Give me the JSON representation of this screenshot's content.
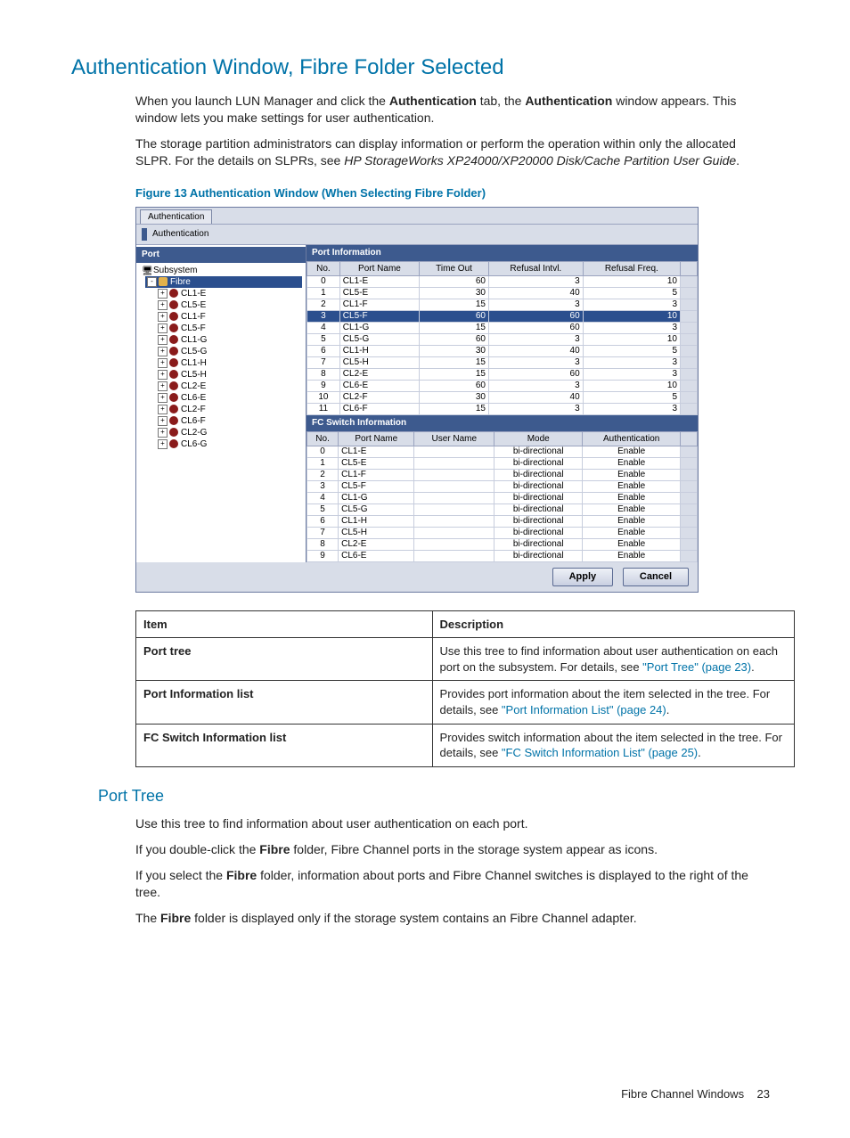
{
  "h1": "Authentication Window, Fibre Folder Selected",
  "p1a": "When you launch LUN Manager and click the ",
  "p1b": "Authentication",
  "p1c": " tab, the ",
  "p1d": "Authentication",
  "p1e": " window appears. This window lets you make settings for user authentication.",
  "p2a": "The storage partition administrators can display information or perform the operation within only the allocated SLPR. For the details on SLPRs, see ",
  "p2b": "HP StorageWorks XP24000/XP20000 Disk/Cache Partition User Guide",
  "p2c": ".",
  "figcap": "Figure 13 Authentication Window (When Selecting Fibre Folder)",
  "shot": {
    "tab": "Authentication",
    "title": "Authentication",
    "left_hdr": "Port",
    "tree_root": "Subsystem",
    "tree_sel": "Fibre",
    "tree_items": [
      "CL1-E",
      "CL5-E",
      "CL1-F",
      "CL5-F",
      "CL1-G",
      "CL5-G",
      "CL1-H",
      "CL5-H",
      "CL2-E",
      "CL6-E",
      "CL2-F",
      "CL6-F",
      "CL2-G",
      "CL6-G"
    ],
    "pi_hdr": "Port Information",
    "pi_cols": [
      "No.",
      "Port Name",
      "Time Out",
      "Refusal Intvl.",
      "Refusal Freq."
    ],
    "pi_rows": [
      {
        "no": "0",
        "name": "CL1-E",
        "to": "60",
        "ri": "3",
        "rf": "10"
      },
      {
        "no": "1",
        "name": "CL5-E",
        "to": "30",
        "ri": "40",
        "rf": "5"
      },
      {
        "no": "2",
        "name": "CL1-F",
        "to": "15",
        "ri": "3",
        "rf": "3"
      },
      {
        "no": "3",
        "name": "CL5-F",
        "to": "60",
        "ri": "60",
        "rf": "10",
        "sel": true
      },
      {
        "no": "4",
        "name": "CL1-G",
        "to": "15",
        "ri": "60",
        "rf": "3"
      },
      {
        "no": "5",
        "name": "CL5-G",
        "to": "60",
        "ri": "3",
        "rf": "10"
      },
      {
        "no": "6",
        "name": "CL1-H",
        "to": "30",
        "ri": "40",
        "rf": "5"
      },
      {
        "no": "7",
        "name": "CL5-H",
        "to": "15",
        "ri": "3",
        "rf": "3"
      },
      {
        "no": "8",
        "name": "CL2-E",
        "to": "15",
        "ri": "60",
        "rf": "3"
      },
      {
        "no": "9",
        "name": "CL6-E",
        "to": "60",
        "ri": "3",
        "rf": "10"
      },
      {
        "no": "10",
        "name": "CL2-F",
        "to": "30",
        "ri": "40",
        "rf": "5"
      },
      {
        "no": "11",
        "name": "CL6-F",
        "to": "15",
        "ri": "3",
        "rf": "3"
      }
    ],
    "fc_hdr": "FC Switch Information",
    "fc_cols": [
      "No.",
      "Port Name",
      "User Name",
      "Mode",
      "Authentication"
    ],
    "fc_rows": [
      {
        "no": "0",
        "name": "CL1-E",
        "user": "",
        "mode": "bi-directional",
        "auth": "Enable"
      },
      {
        "no": "1",
        "name": "CL5-E",
        "user": "",
        "mode": "bi-directional",
        "auth": "Enable"
      },
      {
        "no": "2",
        "name": "CL1-F",
        "user": "",
        "mode": "bi-directional",
        "auth": "Enable"
      },
      {
        "no": "3",
        "name": "CL5-F",
        "user": "",
        "mode": "bi-directional",
        "auth": "Enable"
      },
      {
        "no": "4",
        "name": "CL1-G",
        "user": "",
        "mode": "bi-directional",
        "auth": "Enable"
      },
      {
        "no": "5",
        "name": "CL5-G",
        "user": "",
        "mode": "bi-directional",
        "auth": "Enable"
      },
      {
        "no": "6",
        "name": "CL1-H",
        "user": "",
        "mode": "bi-directional",
        "auth": "Enable"
      },
      {
        "no": "7",
        "name": "CL5-H",
        "user": "",
        "mode": "bi-directional",
        "auth": "Enable"
      },
      {
        "no": "8",
        "name": "CL2-E",
        "user": "",
        "mode": "bi-directional",
        "auth": "Enable"
      },
      {
        "no": "9",
        "name": "CL6-E",
        "user": "",
        "mode": "bi-directional",
        "auth": "Enable"
      }
    ],
    "apply": "Apply",
    "cancel": "Cancel"
  },
  "desc": {
    "h_item": "Item",
    "h_desc": "Description",
    "rows": [
      {
        "item": "Port tree",
        "d1": "Use this tree to find information about user authentication on each port on the subsystem. For details, see ",
        "link": "\"Port Tree\" (page 23)",
        "d2": "."
      },
      {
        "item": "Port Information list",
        "d1": "Provides port information about the item selected in the tree. For details, see ",
        "link": "\"Port Information List\" (page 24)",
        "d2": "."
      },
      {
        "item": "FC Switch Information list",
        "d1": "Provides switch information about the item selected in the tree. For details, see ",
        "link": "\"FC Switch Information List\" (page 25)",
        "d2": "."
      }
    ]
  },
  "h2": "Port Tree",
  "pp1": "Use this tree to find information about user authentication on each port.",
  "pp2a": "If you double-click the ",
  "pp2b": "Fibre",
  "pp2c": " folder, Fibre Channel ports in the storage system appear as icons.",
  "pp3a": "If you select the ",
  "pp3b": "Fibre",
  "pp3c": " folder, information about ports and Fibre Channel switches is displayed to the right of the tree.",
  "pp4a": "The ",
  "pp4b": "Fibre",
  "pp4c": " folder is displayed only if the storage system contains an Fibre Channel adapter.",
  "footer_text": "Fibre Channel Windows",
  "footer_page": "23"
}
